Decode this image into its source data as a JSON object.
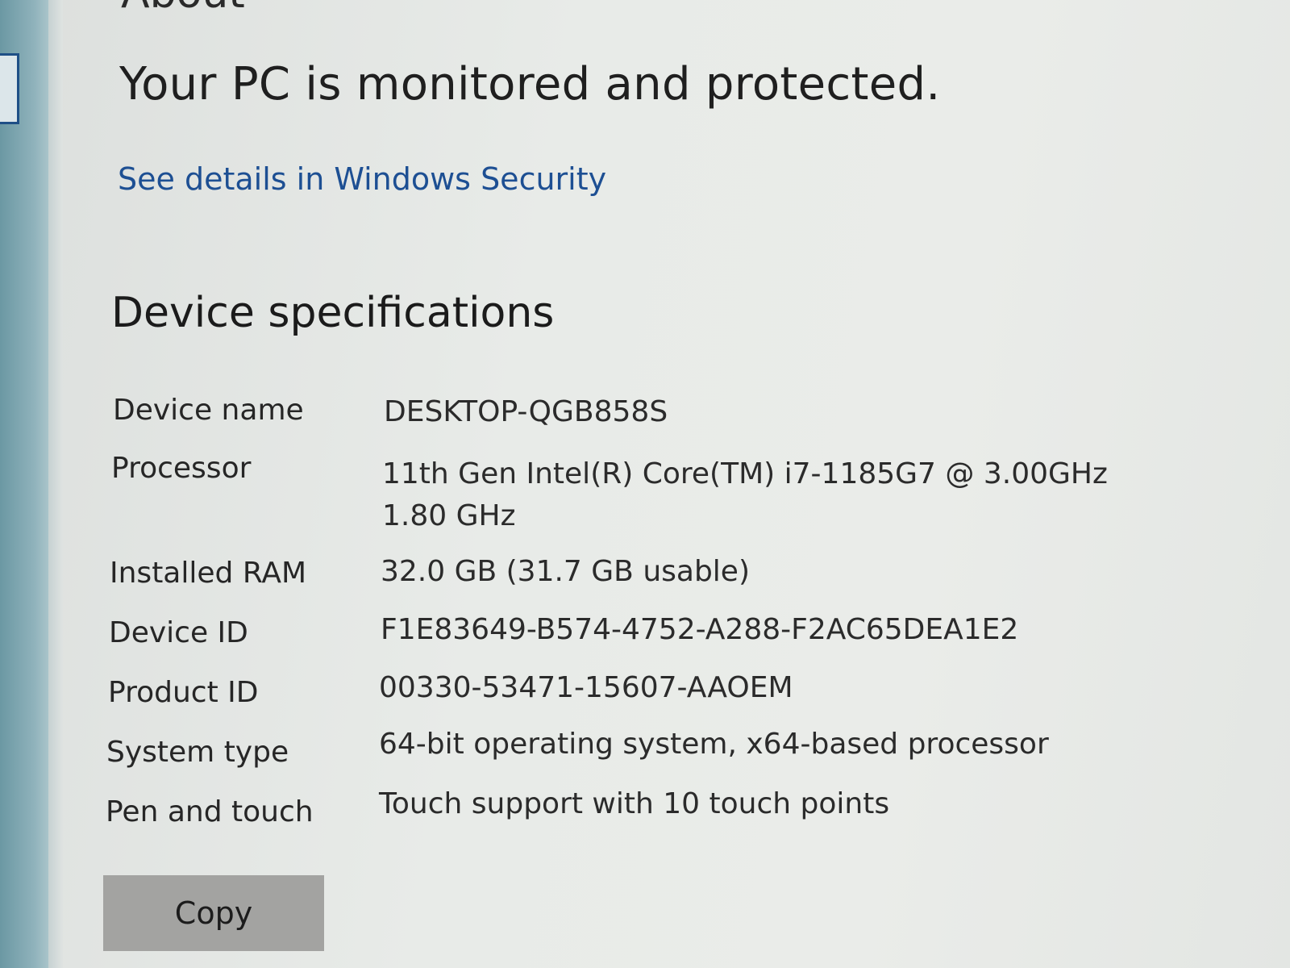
{
  "page": {
    "title": "About"
  },
  "security": {
    "status": "Your PC is monitored and protected.",
    "link": "See details in Windows Security"
  },
  "device_specifications": {
    "heading": "Device specifications",
    "rows": [
      {
        "label": "Device name",
        "value": "DESKTOP-QGB858S"
      },
      {
        "label": "Processor",
        "value": "11th Gen Intel(R) Core(TM) i7-1185G7 @ 3.00GHz   1.80 GHz"
      },
      {
        "label": "Installed RAM",
        "value": "32.0 GB (31.7 GB usable)"
      },
      {
        "label": "Device ID",
        "value": "F1E83649-B574-4752-A288-F2AC65DEA1E2"
      },
      {
        "label": "Product ID",
        "value": "00330-53471-15607-AAOEM"
      },
      {
        "label": "System type",
        "value": "64-bit operating system, x64-based processor"
      },
      {
        "label": "Pen and touch",
        "value": "Touch support with 10 touch points"
      }
    ],
    "copy_label": "Copy"
  },
  "colors": {
    "link": "#1d4f93",
    "accent_strip": "#6b98a3",
    "button_bg": "#a3a3a1"
  }
}
